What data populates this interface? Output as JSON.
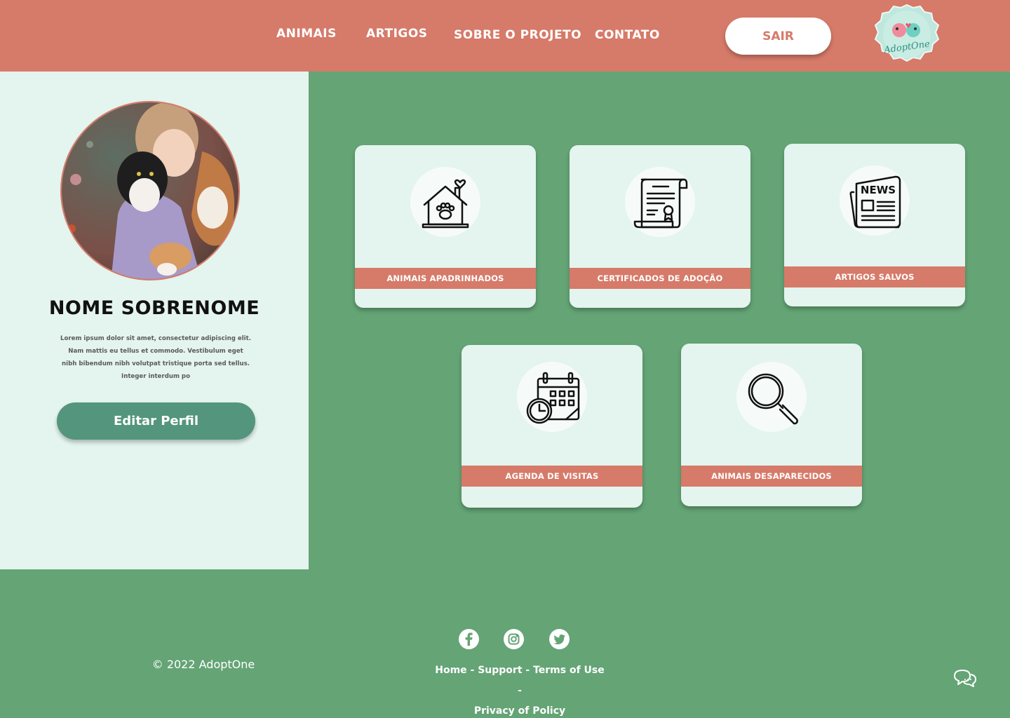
{
  "header": {
    "nav": [
      "ANIMAIS",
      "ARTIGOS",
      "SOBRE O PROJETO",
      "CONTATO"
    ],
    "logout_label": "SAIR",
    "logo_text": "AdoptOne"
  },
  "profile": {
    "name": "NOME SOBRENOME",
    "bio": "Lorem ipsum dolor sit amet, consectetur adipiscing elit. Nam mattis eu tellus et commodo. Vestibulum eget nibh bibendum nibh volutpat tristique porta sed tellus. Integer interdum po",
    "edit_label": "Editar Perfil"
  },
  "cards": [
    {
      "label": "ANIMAIS APADRINHADOS",
      "icon": "house-paw-icon"
    },
    {
      "label": "CERTIFICADOS DE ADOÇÃO",
      "icon": "certificate-scroll-icon"
    },
    {
      "label": "ARTIGOS SALVOS",
      "icon": "newspaper-icon",
      "icon_text": "NEWS"
    },
    {
      "label": "AGENDA DE VISITAS",
      "icon": "calendar-clock-icon"
    },
    {
      "label": "ANIMAIS DESAPARECIDOS",
      "icon": "magnifier-icon"
    }
  ],
  "footer": {
    "social": [
      "facebook-icon",
      "instagram-icon",
      "twitter-icon"
    ],
    "copyright": "© 2022 AdoptOne",
    "links": [
      "Home",
      "Support",
      "Terms of Use",
      "Privacy of Policy"
    ],
    "separator": " - "
  },
  "colors": {
    "header": "#d67a69",
    "page_green": "#64a475",
    "sidebar": "#e4f4ee",
    "button_green": "#53957d"
  }
}
